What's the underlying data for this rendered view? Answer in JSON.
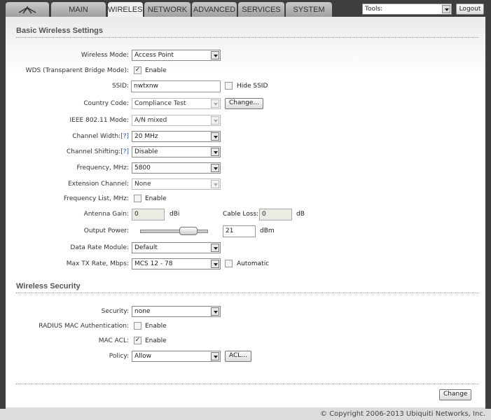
{
  "nav": {
    "tabs": [
      "MAIN",
      "WIRELESS",
      "NETWORK",
      "ADVANCED",
      "SERVICES",
      "SYSTEM"
    ],
    "active": "WIRELESS",
    "tools_label": "Tools:",
    "logout": "Logout"
  },
  "basic": {
    "title": "Basic Wireless Settings",
    "wireless_mode": {
      "label": "Wireless Mode:",
      "value": "Access Point"
    },
    "wds": {
      "label": "WDS (Transparent Bridge Mode):",
      "checked": true,
      "option": "Enable"
    },
    "ssid": {
      "label": "SSID:",
      "value": "nwtxnw",
      "hide_label": "Hide SSID",
      "hide_checked": false
    },
    "country": {
      "label": "Country Code:",
      "value": "Compliance Test",
      "button": "Change..."
    },
    "ieee": {
      "label": "IEEE 802.11 Mode:",
      "value": "A/N mixed"
    },
    "channel_width": {
      "label": "Channel Width:",
      "help": "[?]",
      "value": "20 MHz"
    },
    "channel_shifting": {
      "label": "Channel Shifting:",
      "help": "[?]",
      "value": "Disable"
    },
    "frequency": {
      "label": "Frequency, MHz:",
      "value": "5800"
    },
    "extension": {
      "label": "Extension Channel:",
      "value": "None"
    },
    "freq_list": {
      "label": "Frequency List, MHz:",
      "checked": false,
      "option": "Enable"
    },
    "antenna_gain": {
      "label": "Antenna Gain:",
      "value": "0",
      "unit": "dBi"
    },
    "cable_loss": {
      "label": "Cable Loss:",
      "value": "0",
      "unit": "dB"
    },
    "output_power": {
      "label": "Output Power:",
      "value": "21",
      "unit": "dBm",
      "slider_fraction": 0.78
    },
    "data_rate": {
      "label": "Data Rate Module:",
      "value": "Default"
    },
    "max_tx": {
      "label": "Max TX Rate, Mbps:",
      "value": "MCS 12 - 78",
      "auto_label": "Automatic",
      "auto_checked": false
    }
  },
  "security": {
    "title": "Wireless Security",
    "security": {
      "label": "Security:",
      "value": "none"
    },
    "radius": {
      "label": "RADIUS MAC Authentication:",
      "checked": false,
      "option": "Enable"
    },
    "mac_acl": {
      "label": "MAC ACL:",
      "checked": true,
      "option": "Enable"
    },
    "policy": {
      "label": "Policy:",
      "value": "Allow",
      "button": "ACL..."
    }
  },
  "change_button": "Change",
  "copyright": "© Copyright 2006-2013 Ubiquiti Networks, Inc."
}
